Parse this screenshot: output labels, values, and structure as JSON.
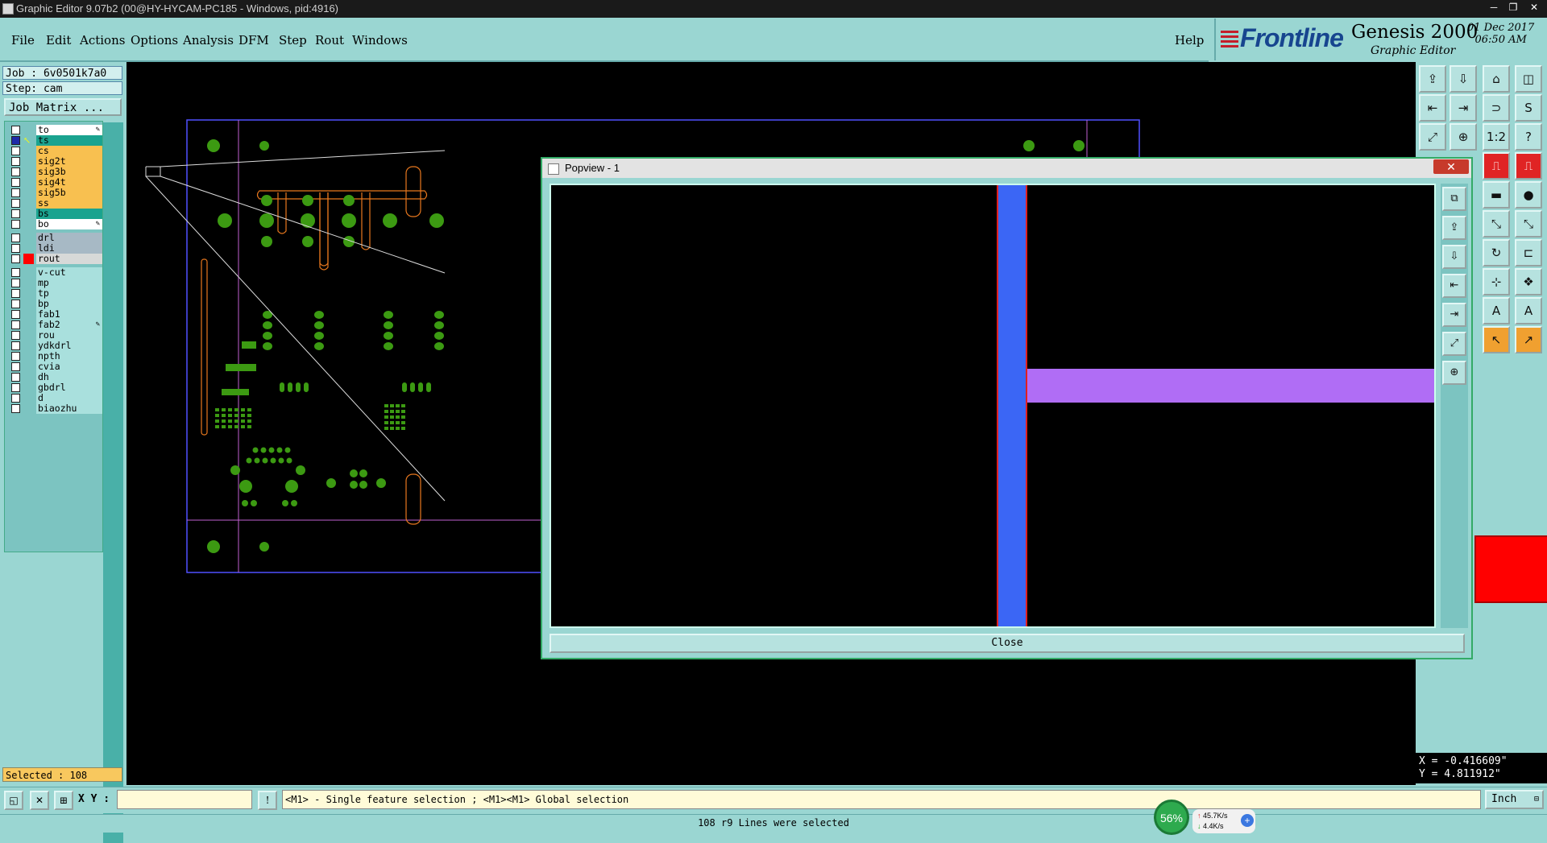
{
  "window": {
    "title": "Graphic Editor 9.07b2 (00@HY-HYCAM-PC185 - Windows, pid:4916)",
    "controls": [
      "─",
      "❐",
      "✕"
    ]
  },
  "menu": {
    "items": [
      "File",
      "Edit",
      "Actions",
      "Options",
      "Analysis",
      "DFM",
      "Step",
      "Rout",
      "Windows"
    ],
    "help": "Help"
  },
  "brand": {
    "logo": "Frontline",
    "product": "Genesis 2000",
    "subtitle": "Graphic Editor",
    "date": "01 Dec 2017",
    "time": "06:50 AM"
  },
  "job": {
    "job_line": "Job : 6v0501k7a0",
    "step_line": "Step: cam",
    "matrix_button": "Job Matrix ..."
  },
  "layers": [
    {
      "name": "to",
      "color": "#ffffff",
      "checked": false,
      "edit": true
    },
    {
      "name": "ts",
      "color": "#1aa38f",
      "checked": true,
      "edit": false,
      "cursor": true
    },
    {
      "name": "cs",
      "color": "#f8c050",
      "checked": false
    },
    {
      "name": "sig2t",
      "color": "#f8c050",
      "checked": false
    },
    {
      "name": "sig3b",
      "color": "#f8c050",
      "checked": false
    },
    {
      "name": "sig4t",
      "color": "#f8c050",
      "checked": false
    },
    {
      "name": "sig5b",
      "color": "#f8c050",
      "checked": false
    },
    {
      "name": "ss",
      "color": "#f8c050",
      "checked": false
    },
    {
      "name": "bs",
      "color": "#1aa38f",
      "checked": false
    },
    {
      "name": "bo",
      "color": "#ffffff",
      "checked": false,
      "edit": true
    },
    {
      "name": "drl",
      "color": "#a7b9c5",
      "checked": false,
      "gap": true
    },
    {
      "name": "ldi",
      "color": "#a7b9c5",
      "checked": false
    },
    {
      "name": "rout",
      "color": "#d7d9d8",
      "checked": false,
      "marker": "#ff0000"
    },
    {
      "name": "v-cut",
      "color": "#a9e0dd",
      "checked": false,
      "gap": true
    },
    {
      "name": "mp",
      "color": "#a9e0dd",
      "checked": false
    },
    {
      "name": "tp",
      "color": "#a9e0dd",
      "checked": false
    },
    {
      "name": "bp",
      "color": "#a9e0dd",
      "checked": false
    },
    {
      "name": "fab1",
      "color": "#a9e0dd",
      "checked": false
    },
    {
      "name": "fab2",
      "color": "#a9e0dd",
      "checked": false,
      "edit": true
    },
    {
      "name": "rou",
      "color": "#a9e0dd",
      "checked": false
    },
    {
      "name": "ydkdrl",
      "color": "#a9e0dd",
      "checked": false
    },
    {
      "name": "npth",
      "color": "#a9e0dd",
      "checked": false
    },
    {
      "name": "cvia",
      "color": "#a9e0dd",
      "checked": false
    },
    {
      "name": "dh",
      "color": "#a9e0dd",
      "checked": false
    },
    {
      "name": "gbdrl",
      "color": "#a9e0dd",
      "checked": false
    },
    {
      "name": "d",
      "color": "#a9e0dd",
      "checked": false
    },
    {
      "name": "biaozhu",
      "color": "#a9e0dd",
      "checked": false
    }
  ],
  "selected_label": "Selected : 108",
  "coords": {
    "x": "X = -0.416609\"",
    "y": "Y = 4.811912\""
  },
  "bottom": {
    "xy_label": "X Y :",
    "xy_value": "",
    "help_text": "<M1> - Single feature selection ; <M1><M1> Global selection",
    "units": "Inch",
    "status": "108 r9 Lines were selected"
  },
  "network": {
    "percent": "56%",
    "up": "45.7K/s",
    "down": "4.4K/s"
  },
  "popview": {
    "title": "Popview - 1",
    "close_label": "Close",
    "colors": {
      "vertical": "#3b66f5",
      "vertical_edge": "#e02020",
      "horizontal": "#b06df5"
    }
  },
  "colors": {
    "outline": "#5050ff",
    "pads": "#3c9a12",
    "rout": "#e8781e",
    "board_line": "#c060d0"
  }
}
